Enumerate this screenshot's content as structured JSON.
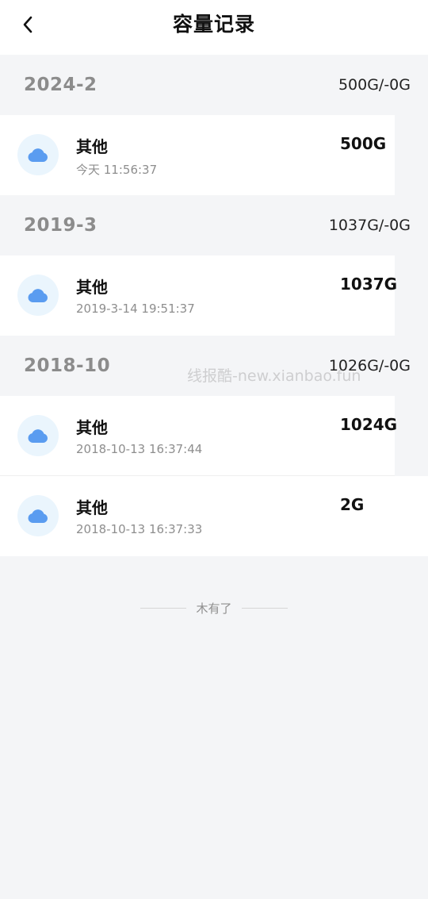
{
  "header": {
    "title": "容量记录",
    "back_icon": "chevron-left-icon"
  },
  "groups": [
    {
      "month": "2024-2",
      "summary": "500G/-0G",
      "items": [
        {
          "name": "其他",
          "time": "今天 11:56:37",
          "amount": "500G"
        }
      ]
    },
    {
      "month": "2019-3",
      "summary": "1037G/-0G",
      "items": [
        {
          "name": "其他",
          "time": "2019-3-14 19:51:37",
          "amount": "1037G"
        }
      ]
    },
    {
      "month": "2018-10",
      "summary": "1026G/-0G",
      "items": [
        {
          "name": "其他",
          "time": "2018-10-13 16:37:44",
          "amount": "1024G"
        },
        {
          "name": "其他",
          "time": "2018-10-13 16:37:33",
          "amount": "2G"
        }
      ]
    }
  ],
  "footer": {
    "end_text": "木有了"
  },
  "watermark": "线报酷-new.xianbao.fun",
  "colors": {
    "cloud": "#5a9cf0",
    "cloud_bg": "#eaf5fd",
    "page_bg": "#f4f5f7"
  }
}
